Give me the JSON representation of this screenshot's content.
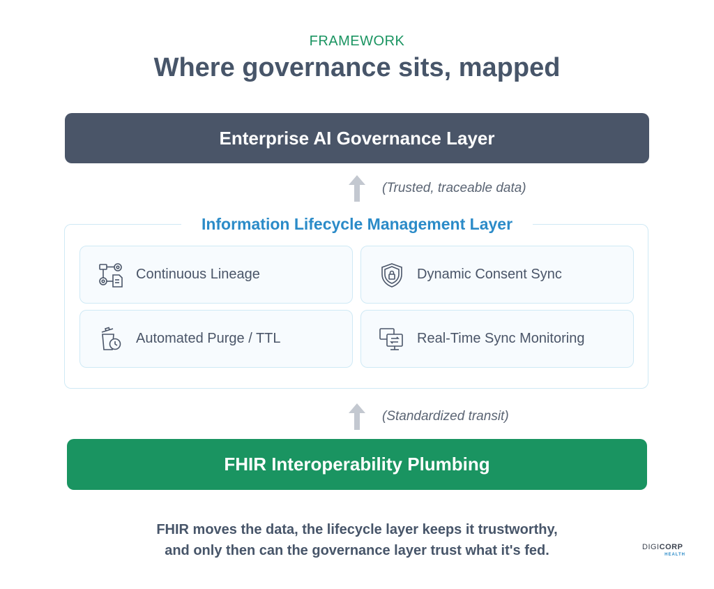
{
  "header": {
    "eyebrow": "FRAMEWORK",
    "title": "Where governance sits, mapped"
  },
  "layers": {
    "top": "Enterprise AI Governance Layer",
    "middle": "Information Lifecycle Management Layer",
    "bottom": "FHIR Interoperability Plumbing"
  },
  "flows": [
    {
      "label": "(Trusted, traceable data)",
      "icon": "arrow-up-icon"
    },
    {
      "label": "(Standardized transit)",
      "icon": "arrow-up-icon"
    }
  ],
  "capabilities": [
    {
      "label": "Continuous Lineage",
      "icon": "lineage-flow-icon"
    },
    {
      "label": "Dynamic Consent Sync",
      "icon": "shield-lock-icon"
    },
    {
      "label": "Automated Purge / TTL",
      "icon": "trash-clock-icon"
    },
    {
      "label": "Real-Time Sync Monitoring",
      "icon": "monitor-sync-icon"
    }
  ],
  "caption": {
    "line1": "FHIR moves the data, the lifecycle layer keeps it trustworthy,",
    "line2": "and only then can the governance layer trust what it's fed."
  },
  "logo": {
    "part1": "DIGI",
    "part2": "CORP",
    "sub": "HEALTH"
  },
  "colors": {
    "governance": "#4a5568",
    "fhir": "#1a9461",
    "lifecycle_title": "#2b8bc8",
    "card_border": "#cfe9f5"
  }
}
